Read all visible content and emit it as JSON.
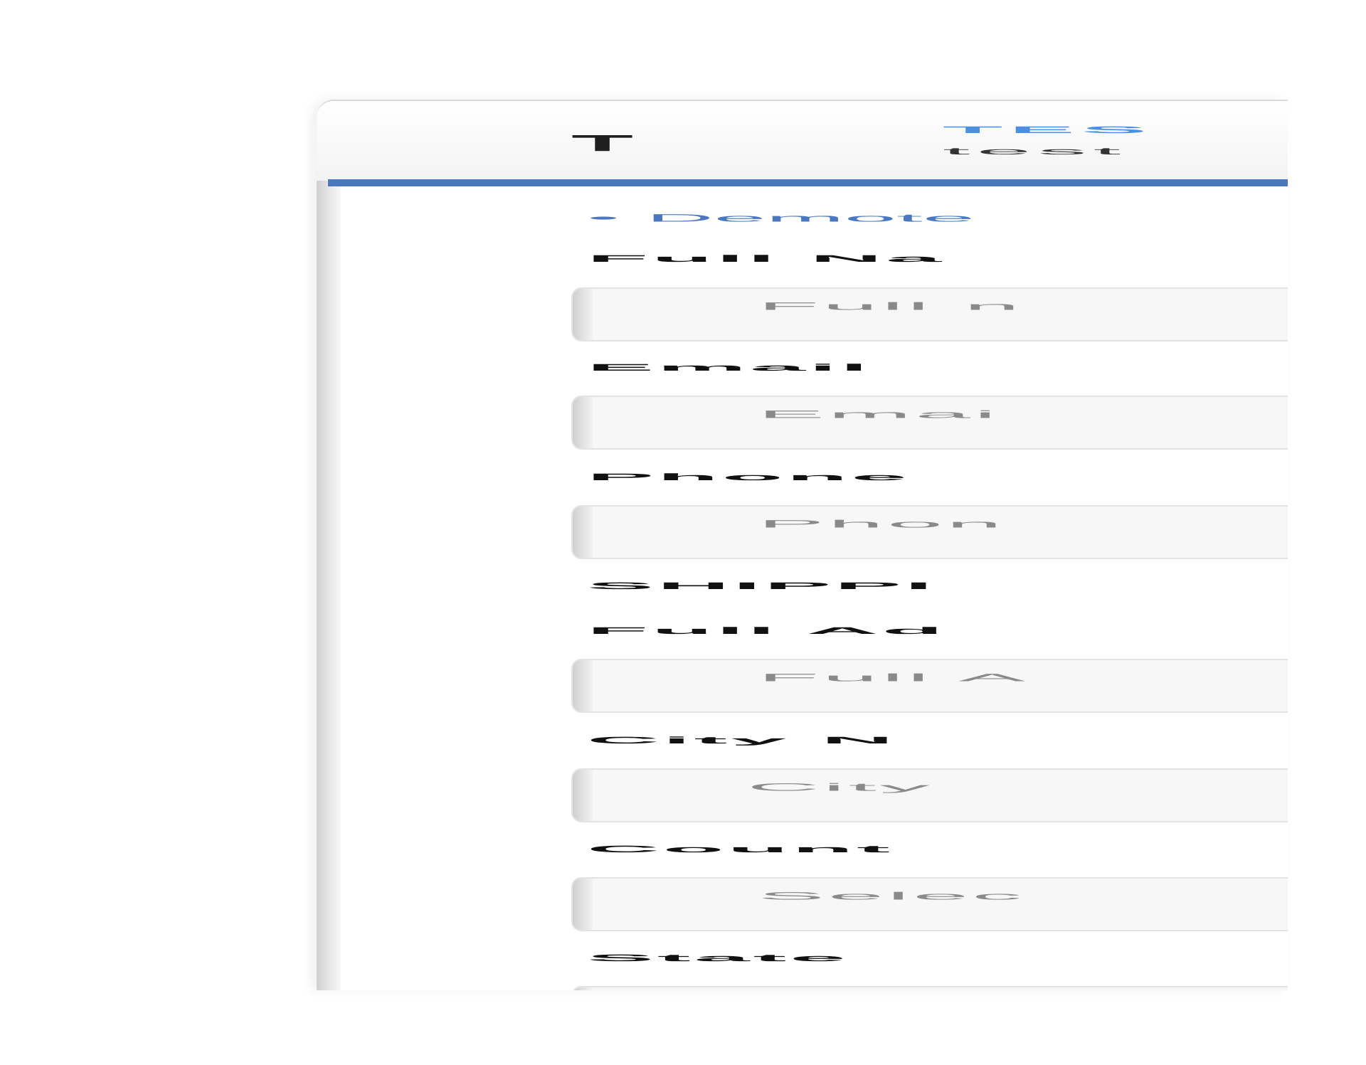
{
  "header": {
    "logo_text": "T",
    "brand_title": "TES",
    "brand_subtitle": "test"
  },
  "demo_link": "• Demote",
  "form": {
    "full_name": {
      "label": "Full Na",
      "placeholder": "Full n"
    },
    "email": {
      "label": "Email",
      "placeholder": "Emai"
    },
    "phone": {
      "label": "Phone",
      "placeholder": "Phon"
    },
    "shipping_section": "SHIPPI",
    "full_address": {
      "label": "Full Ad",
      "placeholder": "Full A"
    },
    "city": {
      "label": "City N",
      "placeholder": "City"
    },
    "country": {
      "label": "Count",
      "placeholder": "Selec"
    },
    "state": {
      "label": "State"
    }
  },
  "colors": {
    "accent": "#4a77c0",
    "brand": "#4a90e2"
  }
}
